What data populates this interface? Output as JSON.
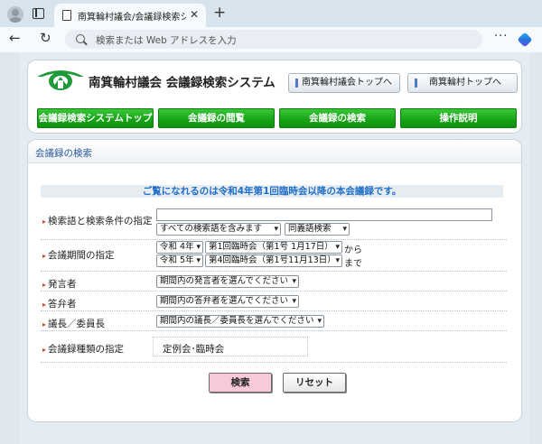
{
  "browser": {
    "tab_title": "南箕輪村議会/会議録検索システム",
    "tab_close": "✕",
    "new_tab": "+",
    "address_placeholder": "検索または Web アドレスを入力",
    "back": "←",
    "reload": "↻",
    "more": "···"
  },
  "header": {
    "title": "南箕輪村議会 会議録検索システム",
    "top_buttons": [
      "南箕輪村議会トップへ",
      "南箕輪村トップへ"
    ],
    "nav": [
      "会議録検索システムトップ",
      "会議録の閲覧",
      "会議録の検索",
      "操作説明"
    ]
  },
  "search": {
    "section_title": "会議録の検索",
    "notice": "ご覧になれるのは令和4年第1回臨時会以降の本会議録です。",
    "labels": {
      "keyword": "検索語と検索条件の指定",
      "period": "会議期間の指定",
      "speaker": "発言者",
      "answerer": "答弁者",
      "chair": "議長／委員長",
      "type": "会議録種類の指定"
    },
    "keyword_value": "",
    "keyword_mode": "すべての検索語を含みます",
    "synonym": "同義語検索",
    "period": {
      "from_year": "令和 4年",
      "from_session": "第1回臨時会（第1号 1月17日）",
      "from_suffix": "から",
      "to_year": "令和 5年",
      "to_session": "第4回臨時会（第1号11月13日）",
      "to_suffix": "まで"
    },
    "speaker_select": "期間内の発言者を選んでください",
    "answerer_select": "期間内の答弁者を選んでください",
    "chair_select": "期間内の議長／委員長を選んでください",
    "type_value": "定例会･臨時会",
    "search_button": "検索",
    "reset_button": "リセット"
  },
  "colors": {
    "nav_green": "#16a216",
    "notice_blue": "#1e6ec8",
    "search_button_pink": "#f8c9d7"
  }
}
